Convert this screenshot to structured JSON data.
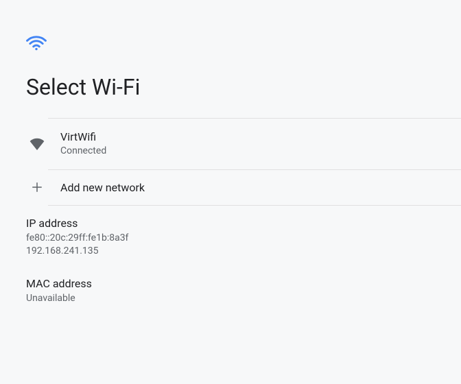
{
  "header": {
    "title": "Select Wi-Fi"
  },
  "network": {
    "name": "VirtWifi",
    "status": "Connected"
  },
  "add_network": {
    "label": "Add new network"
  },
  "ip": {
    "label": "IP address",
    "ipv6": "fe80::20c:29ff:fe1b:8a3f",
    "ipv4": "192.168.241.135"
  },
  "mac": {
    "label": "MAC address",
    "value": "Unavailable"
  }
}
